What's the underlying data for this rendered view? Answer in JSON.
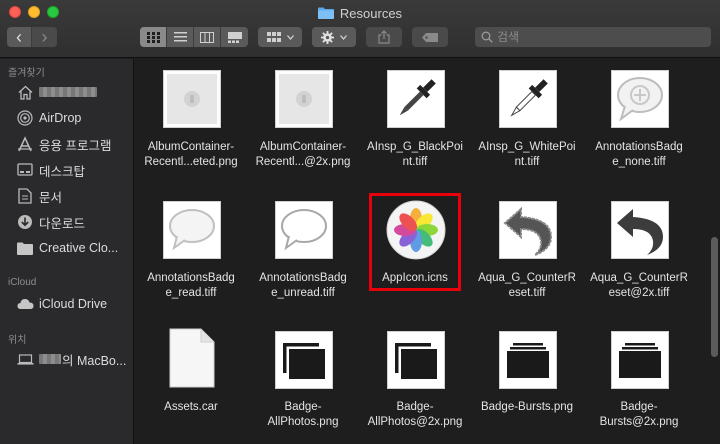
{
  "window": {
    "title": "Resources"
  },
  "toolbar": {
    "back": "‹",
    "forward": "›",
    "search_placeholder": "검색"
  },
  "sidebar": {
    "favorites_header": "즐겨찾기",
    "favorites": [
      {
        "label": "AirDrop",
        "icon": "airdrop-icon"
      },
      {
        "label": "응용 프로그램",
        "icon": "applications-icon"
      },
      {
        "label": "데스크탑",
        "icon": "desktop-icon"
      },
      {
        "label": "문서",
        "icon": "document-icon"
      },
      {
        "label": "다운로드",
        "icon": "download-icon"
      },
      {
        "label": "Creative Clo...",
        "icon": "folder-icon"
      }
    ],
    "icloud_header": "iCloud",
    "icloud_drive": "iCloud Drive",
    "locations_header": "위치",
    "macbook_suffix": "의 MacBo..."
  },
  "files": [
    {
      "line1": "AlbumContainer-",
      "line2": "Recentl...eted.png",
      "kind": "png-thumb"
    },
    {
      "line1": "AlbumContainer-",
      "line2": "Recentl...@2x.png",
      "kind": "png-thumb"
    },
    {
      "line1": "AInsp_G_BlackPoi",
      "line2": "nt.tiff",
      "kind": "dropper"
    },
    {
      "line1": "AInsp_G_WhitePoi",
      "line2": "nt.tiff",
      "kind": "dropper"
    },
    {
      "line1": "AnnotationsBadg",
      "line2": "e_none.tiff",
      "kind": "bubble-plus"
    },
    {
      "line1": "AnnotationsBadg",
      "line2": "e_read.tiff",
      "kind": "bubble"
    },
    {
      "line1": "AnnotationsBadg",
      "line2": "e_unread.tiff",
      "kind": "bubble-white"
    },
    {
      "line1": "AppIcon.icns",
      "line2": "",
      "kind": "photos-icon",
      "highlighted": true
    },
    {
      "line1": "Aqua_G_CounterR",
      "line2": "eset.tiff",
      "kind": "counter-reset"
    },
    {
      "line1": "Aqua_G_CounterR",
      "line2": "eset@2x.tiff",
      "kind": "counter-reset-2x"
    },
    {
      "line1": "Assets.car",
      "line2": "",
      "kind": "doc"
    },
    {
      "line1": "Badge-",
      "line2": "AllPhotos.png",
      "kind": "badge-all"
    },
    {
      "line1": "Badge-",
      "line2": "AllPhotos@2x.png",
      "kind": "badge-all"
    },
    {
      "line1": "Badge-Bursts.png",
      "line2": "",
      "kind": "badge-bursts"
    },
    {
      "line1": "Badge-",
      "line2": "Bursts@2x.png",
      "kind": "badge-bursts"
    }
  ],
  "colors": {
    "highlight": "#e8000b",
    "accent": "#3b99fc"
  }
}
